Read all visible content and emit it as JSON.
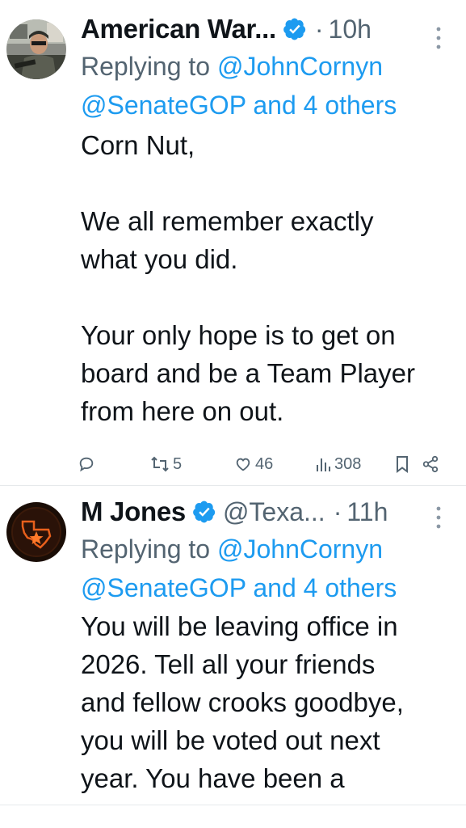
{
  "tweets": [
    {
      "display_name": "American War...",
      "handle": "",
      "dot": "·",
      "time": "10h",
      "replying_prefix": "Replying to ",
      "replying_to_line1": "@JohnCornyn",
      "replying_to_line2": "@SenateGOP and 4 others",
      "text": "Corn Nut,\n\nWe all remember exactly\nwhat you did.\n\nYour only hope is to get on\nboard and be a Team Player\nfrom here on out.",
      "retweets": "5",
      "likes": "46",
      "views": "308",
      "verified_color": "#1d9bf0",
      "icons": [
        "reply-icon",
        "retweet-icon",
        "like-icon",
        "views-icon",
        "bookmark-icon",
        "share-icon"
      ]
    },
    {
      "display_name": "M Jones",
      "handle": "@Texa...",
      "dot": "·",
      "time": "11h",
      "replying_prefix": "Replying to ",
      "replying_to_line1": "@JohnCornyn",
      "replying_to_line2": "@SenateGOP and 4 others",
      "text": "You will be leaving office in\n2026. Tell all your friends\nand fellow crooks goodbye,\nyou will be voted out next\nyear.  You have been a",
      "verified_color": "#1d9bf0"
    }
  ],
  "colors": {
    "text": "#0f1419",
    "secondary": "#536471",
    "link": "#1d9bf0",
    "divider": "#e6e9eb"
  }
}
